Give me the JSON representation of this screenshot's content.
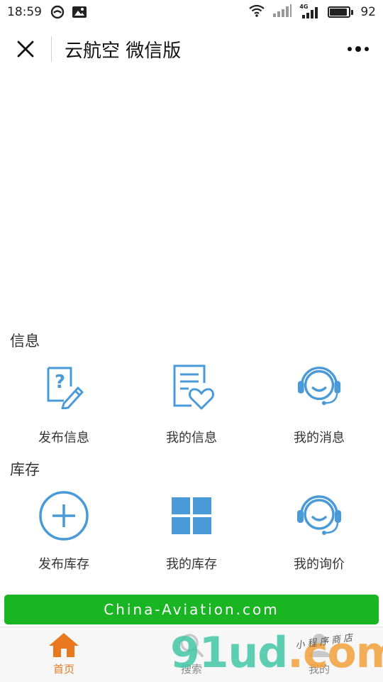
{
  "status_bar": {
    "time": "18:59",
    "network": "4G",
    "battery": "92",
    "battery_level": 0.92
  },
  "nav": {
    "title": "云航空 微信版"
  },
  "sections": [
    {
      "title": "信息",
      "items": [
        {
          "label": "发布信息",
          "icon": "edit-question-icon"
        },
        {
          "label": "我的信息",
          "icon": "document-heart-icon"
        },
        {
          "label": "我的消息",
          "icon": "headset-service-icon"
        }
      ]
    },
    {
      "title": "库存",
      "items": [
        {
          "label": "发布库存",
          "icon": "plus-circle-icon"
        },
        {
          "label": "我的库存",
          "icon": "grid-icon"
        },
        {
          "label": "我的询价",
          "icon": "headset-service-icon"
        }
      ]
    }
  ],
  "banner": {
    "text": "China-Aviation.com"
  },
  "tabs": [
    {
      "label": "首页",
      "icon": "home-icon",
      "active": true
    },
    {
      "label": "搜索",
      "icon": "search-icon",
      "active": false
    },
    {
      "label": "我的",
      "icon": "user-icon",
      "active": false
    }
  ],
  "watermark": {
    "brand_a": "91ud",
    "brand_b": ".com",
    "sub": "小程序商店"
  },
  "colors": {
    "accent_blue": "#4a9ad8",
    "banner_green": "#1ab522",
    "tab_active": "#e8791f"
  }
}
